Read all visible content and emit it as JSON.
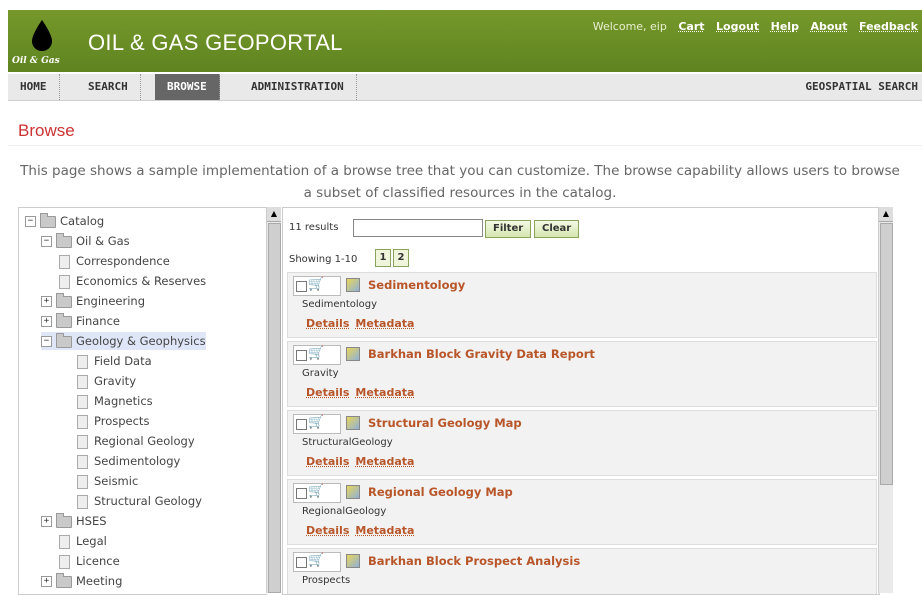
{
  "header": {
    "logo_text": "Oil & Gas",
    "app_title": "OIL & GAS GEOPORTAL",
    "welcome": "Welcome, eip",
    "links": [
      "Cart",
      "Logout",
      "Help",
      "About",
      "Feedback"
    ]
  },
  "nav": {
    "items": [
      "HOME",
      "SEARCH",
      "BROWSE",
      "ADMINISTRATION"
    ],
    "active": "BROWSE",
    "right": "GEOSPATIAL SEARCH"
  },
  "page": {
    "title": "Browse",
    "intro": "This page shows a sample implementation of a browse tree that you can customize. The browse capability allows users to browse a subset of classified resources in the catalog."
  },
  "tree": [
    {
      "label": "Catalog",
      "type": "folder",
      "expander": "−",
      "level": 0
    },
    {
      "label": "Oil & Gas",
      "type": "folder",
      "expander": "−",
      "level": 1
    },
    {
      "label": "Correspondence",
      "type": "doc",
      "level": 2
    },
    {
      "label": "Economics & Reserves",
      "type": "doc",
      "level": 2
    },
    {
      "label": "Engineering",
      "type": "folder",
      "expander": "+",
      "level": 1
    },
    {
      "label": "Finance",
      "type": "folder",
      "expander": "+",
      "level": 1
    },
    {
      "label": "Geology & Geophysics",
      "type": "folder",
      "expander": "−",
      "level": 1,
      "selected": true
    },
    {
      "label": "Field Data",
      "type": "doc",
      "level": 3
    },
    {
      "label": "Gravity",
      "type": "doc",
      "level": 3
    },
    {
      "label": "Magnetics",
      "type": "doc",
      "level": 3
    },
    {
      "label": "Prospects",
      "type": "doc",
      "level": 3
    },
    {
      "label": "Regional Geology",
      "type": "doc",
      "level": 3
    },
    {
      "label": "Sedimentology",
      "type": "doc",
      "level": 3
    },
    {
      "label": "Seismic",
      "type": "doc",
      "level": 3
    },
    {
      "label": "Structural Geology",
      "type": "doc",
      "level": 3
    },
    {
      "label": "HSES",
      "type": "folder",
      "expander": "+",
      "level": 1
    },
    {
      "label": "Legal",
      "type": "doc",
      "level": 2
    },
    {
      "label": "Licence",
      "type": "doc",
      "level": 2
    },
    {
      "label": "Meeting",
      "type": "folder",
      "expander": "+",
      "level": 1
    }
  ],
  "results": {
    "count_label": "11 results",
    "filter_value": "",
    "filter_button": "Filter",
    "clear_button": "Clear",
    "showing": "Showing 1-10",
    "pages": [
      "1",
      "2"
    ],
    "details_label": "Details",
    "metadata_label": "Metadata",
    "records": [
      {
        "title": "Sedimentology",
        "desc": "Sedimentology"
      },
      {
        "title": "Barkhan Block Gravity Data Report",
        "desc": "Gravity"
      },
      {
        "title": "Structural Geology Map",
        "desc": "StructuralGeology"
      },
      {
        "title": "Regional Geology Map",
        "desc": "RegionalGeology"
      },
      {
        "title": "Barkhan Block Prospect Analysis",
        "desc": "Prospects"
      }
    ]
  },
  "colors": {
    "banner": "#6b8e23",
    "title_red": "#cc3333",
    "record_title": "#b8562a"
  }
}
